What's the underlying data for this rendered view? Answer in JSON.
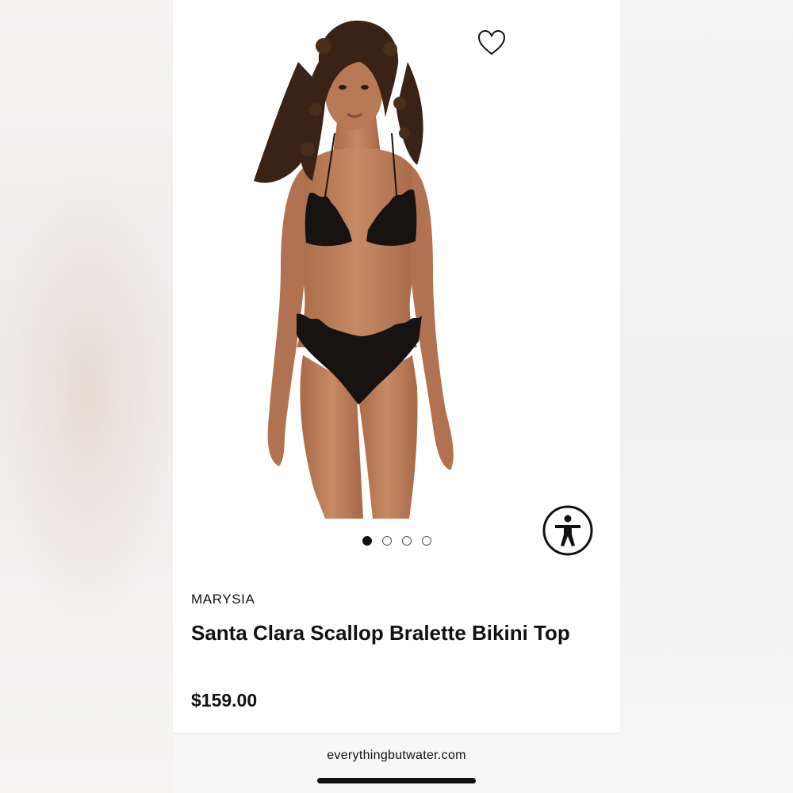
{
  "product": {
    "brand": "MARYSIA",
    "title": "Santa Clara Scallop Bralette Bikini Top",
    "price": "$159.00",
    "image": "model-wearing-black-scalloped-bikini",
    "gallery": {
      "total": 4,
      "active_index": 0
    }
  },
  "icons": {
    "favorite": "heart-icon",
    "accessibility": "accessibility-person-icon"
  },
  "browser": {
    "url": "everythingbutwater.com"
  },
  "colors": {
    "text": "#111111",
    "swimsuit": "#161312",
    "skin": "#b77a57",
    "hair": "#3a2316",
    "page_background": "#ffffff"
  }
}
